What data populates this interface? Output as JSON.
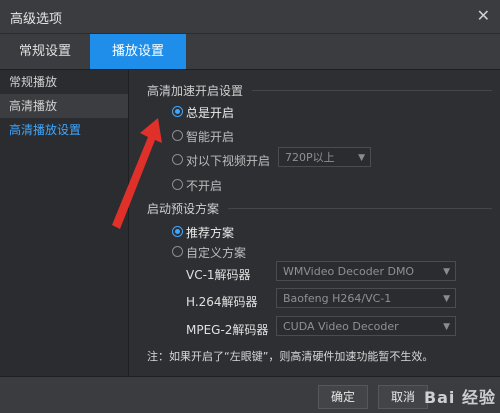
{
  "window": {
    "title": "高级选项",
    "close_glyph": "✕"
  },
  "tabs": [
    {
      "label": "常规设置",
      "active": false
    },
    {
      "label": "播放设置",
      "active": true
    }
  ],
  "sidebar": {
    "items": [
      {
        "label": "常规播放"
      },
      {
        "label": "高清播放",
        "selected": true
      },
      {
        "label": "高清播放设置",
        "highlight": true
      }
    ]
  },
  "hd_accel": {
    "title": "高清加速开启设置",
    "options": [
      {
        "label": "总是开启",
        "checked": true
      },
      {
        "label": "智能开启",
        "checked": false
      },
      {
        "label": "对以下视频开启",
        "checked": false
      },
      {
        "label": "不开启",
        "checked": false
      }
    ],
    "resolution_select": "720P以上"
  },
  "preset": {
    "title": "启动预设方案",
    "options": [
      {
        "label": "推荐方案",
        "checked": true
      },
      {
        "label": "自定义方案",
        "checked": false
      }
    ],
    "decoders": [
      {
        "label": "VC-1解码器",
        "value": "WMVideo Decoder DMO"
      },
      {
        "label": "H.264解码器",
        "value": "Baofeng H264/VC-1"
      },
      {
        "label": "MPEG-2解码器",
        "value": "CUDA Video Decoder"
      }
    ]
  },
  "note": "注：如果开启了“左眼键”，则高清硬件加速功能暂不生效。",
  "footer": {
    "ok_label": "确定",
    "cancel_label": "取消",
    "watermark": "Bai 经验"
  },
  "colors": {
    "accent": "#1e8eea",
    "arrow": "#e0302a",
    "background": "#2b2d30"
  }
}
